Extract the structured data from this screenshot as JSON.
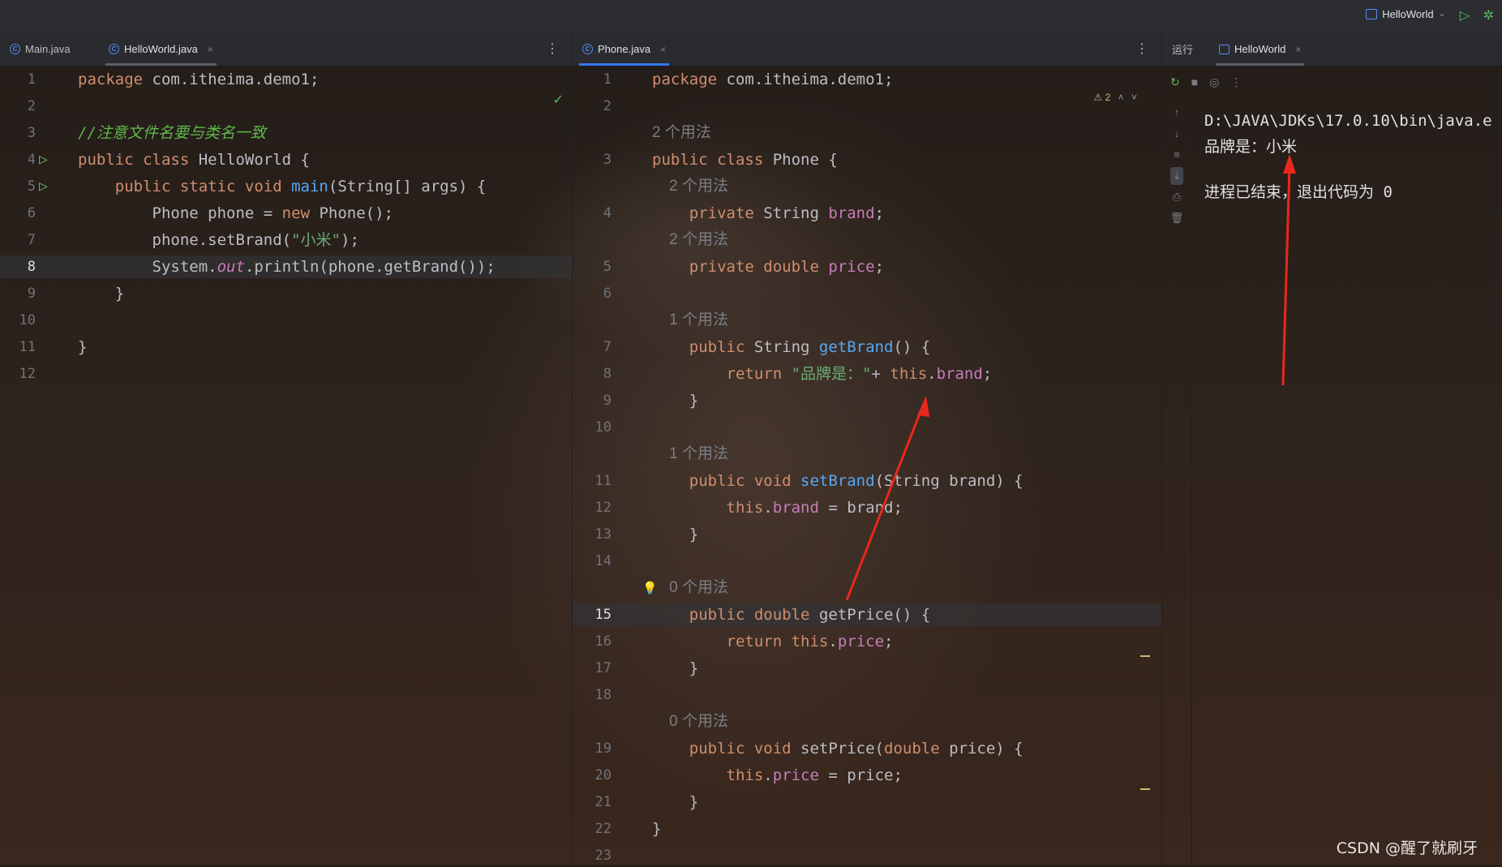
{
  "topbar": {
    "run_config": "HelloWorld",
    "run_icon": "play-icon",
    "debug_icon": "debug-icon"
  },
  "left_editor": {
    "tabs": [
      {
        "label": "Main.java",
        "active": false
      },
      {
        "label": "HelloWorld.java",
        "active": true
      }
    ],
    "lines": [
      {
        "n": "1",
        "tokens": [
          [
            "kw",
            "package "
          ],
          [
            "plain",
            "com.itheima.demo1;"
          ]
        ]
      },
      {
        "n": "2",
        "tokens": []
      },
      {
        "n": "3",
        "tokens": [
          [
            "cmt",
            "//注意文件名要与类名一致"
          ]
        ]
      },
      {
        "n": "4",
        "tokens": [
          [
            "kw",
            "public class "
          ],
          [
            "plain",
            "HelloWorld {"
          ]
        ],
        "run": true
      },
      {
        "n": "5",
        "tokens": [
          [
            "plain",
            "    "
          ],
          [
            "kw",
            "public static void "
          ],
          [
            "fn",
            "main"
          ],
          [
            "plain",
            "(String[] args) {"
          ]
        ],
        "run": true
      },
      {
        "n": "6",
        "tokens": [
          [
            "plain",
            "        Phone phone = "
          ],
          [
            "kw",
            "new "
          ],
          [
            "plain",
            "Phone();"
          ]
        ]
      },
      {
        "n": "7",
        "tokens": [
          [
            "plain",
            "        phone.setBrand("
          ],
          [
            "str",
            "\"小米\""
          ],
          [
            "plain",
            ");"
          ]
        ]
      },
      {
        "n": "8",
        "tokens": [
          [
            "plain",
            "        System."
          ],
          [
            "stat",
            "out"
          ],
          [
            "plain",
            ".println(phone.getBrand());"
          ]
        ],
        "current": true
      },
      {
        "n": "9",
        "tokens": [
          [
            "plain",
            "    }"
          ]
        ]
      },
      {
        "n": "10",
        "tokens": []
      },
      {
        "n": "11",
        "tokens": [
          [
            "plain",
            "}"
          ]
        ]
      },
      {
        "n": "12",
        "tokens": []
      }
    ]
  },
  "mid_editor": {
    "tabs": [
      {
        "label": "Phone.java",
        "active": true
      }
    ],
    "warning_count": "2",
    "lines": [
      {
        "n": "1",
        "tokens": [
          [
            "kw",
            "package "
          ],
          [
            "plain",
            "com.itheima.demo1;"
          ]
        ]
      },
      {
        "n": "2",
        "tokens": []
      },
      {
        "n": "",
        "hint": "2 个用法"
      },
      {
        "n": "3",
        "tokens": [
          [
            "kw",
            "public class "
          ],
          [
            "plain",
            "Phone {"
          ]
        ]
      },
      {
        "n": "",
        "hint": "    2 个用法"
      },
      {
        "n": "4",
        "tokens": [
          [
            "plain",
            "    "
          ],
          [
            "kw",
            "private "
          ],
          [
            "plain",
            "String "
          ],
          [
            "fld",
            "brand"
          ],
          [
            "plain",
            ";"
          ]
        ]
      },
      {
        "n": "",
        "hint": "    2 个用法"
      },
      {
        "n": "5",
        "tokens": [
          [
            "plain",
            "    "
          ],
          [
            "kw",
            "private double "
          ],
          [
            "fld",
            "price"
          ],
          [
            "plain",
            ";"
          ]
        ]
      },
      {
        "n": "6",
        "tokens": []
      },
      {
        "n": "",
        "hint": "    1 个用法"
      },
      {
        "n": "7",
        "tokens": [
          [
            "plain",
            "    "
          ],
          [
            "kw",
            "public "
          ],
          [
            "plain",
            "String "
          ],
          [
            "fn",
            "getBrand"
          ],
          [
            "plain",
            "() {"
          ]
        ]
      },
      {
        "n": "8",
        "tokens": [
          [
            "plain",
            "        "
          ],
          [
            "kw",
            "return "
          ],
          [
            "str",
            "\"品牌是：\""
          ],
          [
            "plain",
            "+ "
          ],
          [
            "kw",
            "this"
          ],
          [
            "plain",
            "."
          ],
          [
            "fld",
            "brand"
          ],
          [
            "plain",
            ";"
          ]
        ]
      },
      {
        "n": "9",
        "tokens": [
          [
            "plain",
            "    }"
          ]
        ]
      },
      {
        "n": "10",
        "tokens": []
      },
      {
        "n": "",
        "hint": "    1 个用法"
      },
      {
        "n": "11",
        "tokens": [
          [
            "plain",
            "    "
          ],
          [
            "kw",
            "public void "
          ],
          [
            "fn",
            "setBrand"
          ],
          [
            "plain",
            "(String brand) {"
          ]
        ]
      },
      {
        "n": "12",
        "tokens": [
          [
            "plain",
            "        "
          ],
          [
            "kw",
            "this"
          ],
          [
            "plain",
            "."
          ],
          [
            "fld",
            "brand"
          ],
          [
            "plain",
            " = brand;"
          ]
        ]
      },
      {
        "n": "13",
        "tokens": [
          [
            "plain",
            "    }"
          ]
        ]
      },
      {
        "n": "14",
        "tokens": []
      },
      {
        "n": "",
        "hint": "    0 个用法",
        "bulb": true
      },
      {
        "n": "15",
        "tokens": [
          [
            "plain",
            "    "
          ],
          [
            "kw",
            "public double "
          ],
          [
            "plain",
            "getPrice() {"
          ]
        ],
        "current": true
      },
      {
        "n": "16",
        "tokens": [
          [
            "plain",
            "        "
          ],
          [
            "kw",
            "return this"
          ],
          [
            "plain",
            "."
          ],
          [
            "fld",
            "price"
          ],
          [
            "plain",
            ";"
          ]
        ]
      },
      {
        "n": "17",
        "tokens": [
          [
            "plain",
            "    }"
          ]
        ]
      },
      {
        "n": "18",
        "tokens": []
      },
      {
        "n": "",
        "hint": "    0 个用法"
      },
      {
        "n": "19",
        "tokens": [
          [
            "plain",
            "    "
          ],
          [
            "kw",
            "public void "
          ],
          [
            "plain",
            "setPrice("
          ],
          [
            "kw",
            "double "
          ],
          [
            "plain",
            "price) {"
          ]
        ]
      },
      {
        "n": "20",
        "tokens": [
          [
            "plain",
            "        "
          ],
          [
            "kw",
            "this"
          ],
          [
            "plain",
            "."
          ],
          [
            "fld",
            "price"
          ],
          [
            "plain",
            " = price;"
          ]
        ]
      },
      {
        "n": "21",
        "tokens": [
          [
            "plain",
            "    }"
          ]
        ]
      },
      {
        "n": "22",
        "tokens": [
          [
            "plain",
            "}"
          ]
        ]
      },
      {
        "n": "23",
        "tokens": []
      }
    ]
  },
  "run_panel": {
    "title": "运行",
    "tab": "HelloWorld",
    "output": [
      "D:\\JAVA\\JDKs\\17.0.10\\bin\\java.e",
      "品牌是：小米",
      "",
      "进程已结束，退出代码为 0"
    ]
  },
  "watermark": "CSDN @醒了就刷牙",
  "colors": {
    "keyword": "#cf8e6d",
    "function": "#56a8f5",
    "field": "#c77dbb",
    "string": "#6aab73",
    "comment": "#5fb84a",
    "annotation_arrow": "#e8281c"
  }
}
